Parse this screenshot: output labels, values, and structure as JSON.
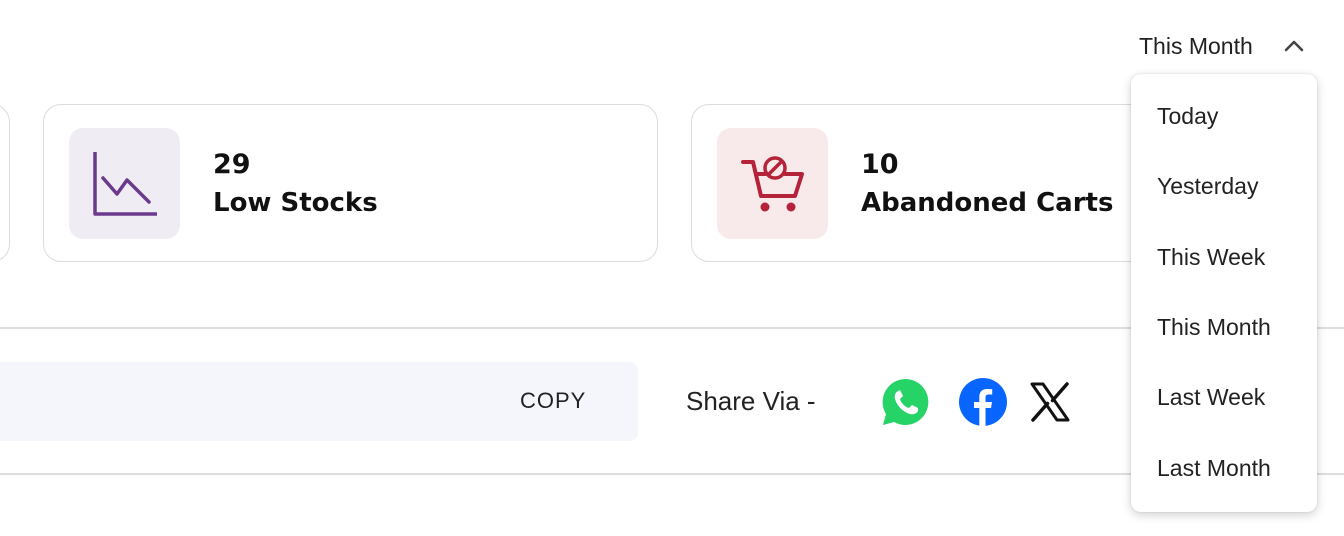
{
  "period_select": {
    "selected": "This Month"
  },
  "stats": [
    {
      "value": "29",
      "label": "Low Stocks",
      "icon": "trend-down-chart-icon",
      "color": "#6b3a8c",
      "bg": "#efedf3"
    },
    {
      "value": "10",
      "label": "Abandoned Carts",
      "icon": "cart-blocked-icon",
      "color": "#b4233a",
      "bg": "#f8eaea"
    }
  ],
  "share": {
    "copy_label": "COPY",
    "share_label": "Share Via -",
    "icons": [
      "whatsapp-icon",
      "facebook-icon",
      "x-icon"
    ]
  },
  "dropdown": {
    "options": [
      "Today",
      "Yesterday",
      "This Week",
      "This Month",
      "Last Week",
      "Last Month"
    ]
  }
}
